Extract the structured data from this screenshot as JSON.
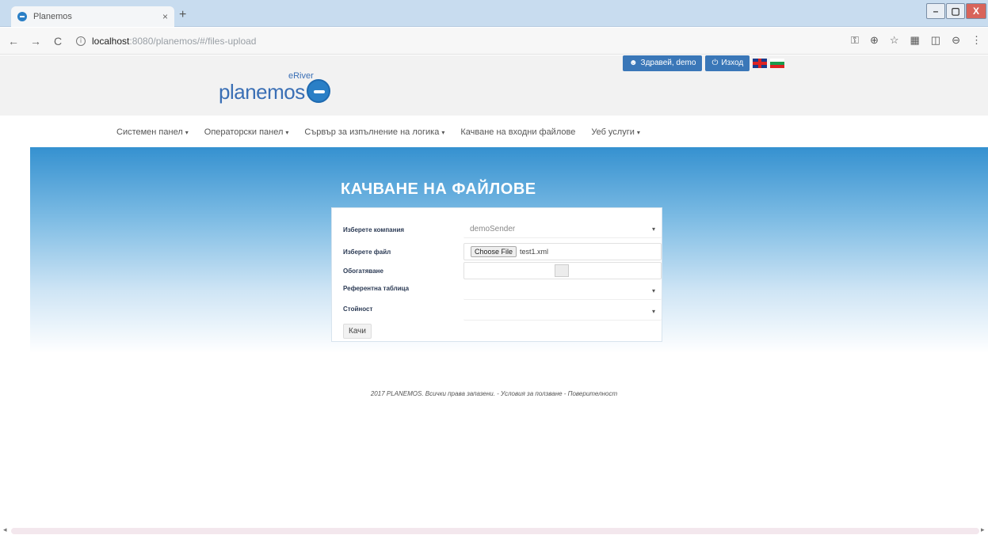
{
  "browser": {
    "tab_title": "Planemos",
    "tab_close": "×",
    "new_tab": "+",
    "url_host": "localhost",
    "url_rest": ":8080/planemos/#/files-upload",
    "win_min": "–",
    "win_max": "▢",
    "win_close": "X"
  },
  "header": {
    "greeting": "Здравей, demo",
    "logout": "Изход",
    "logo_text": "planemos",
    "logo_super": "eRiver"
  },
  "menu": {
    "items": [
      {
        "label": "Системен панел",
        "caret": "▾"
      },
      {
        "label": "Операторски панел",
        "caret": "▾"
      },
      {
        "label": "Сървър за изпълнение на логика",
        "caret": "▾"
      },
      {
        "label": "Качване на входни файлове",
        "caret": ""
      },
      {
        "label": "Уеб услуги",
        "caret": "▾"
      }
    ]
  },
  "page": {
    "title": "КАЧВАНЕ НА ФАЙЛОВЕ"
  },
  "form": {
    "company_label": "Изберете компания",
    "company_value": "demoSender",
    "file_label": "Изберете файл",
    "file_button": "Choose File",
    "file_name": "test1.xml",
    "enrich_label": "Обогатяване",
    "ref_table_label": "Референтна таблица",
    "value_label": "Стойност",
    "submit_label": "Качи",
    "caret": "▾"
  },
  "footer": {
    "text": "2017 PLANEMOS. Всички права запазени. - Условия за ползване - Поверителност"
  }
}
